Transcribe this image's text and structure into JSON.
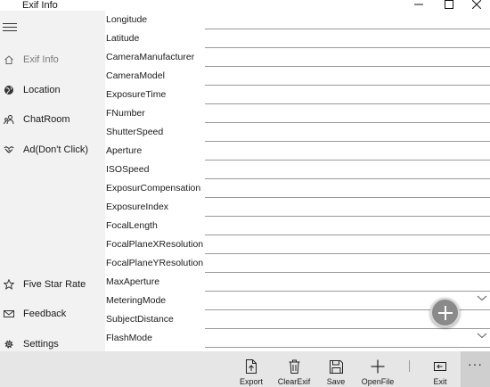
{
  "window": {
    "title": "Exif Info",
    "controls": [
      "minimize-icon",
      "maximize-icon",
      "close-icon"
    ]
  },
  "sidebar": {
    "menu_icon": "hamburger-icon",
    "top_items": [
      {
        "label": "Exif Info",
        "icon": "home-icon",
        "active": true
      },
      {
        "label": "Location",
        "icon": "globe-icon"
      },
      {
        "label": "ChatRoom",
        "icon": "people-icon"
      },
      {
        "label": "Ad(Don't Click)",
        "icon": "handshake-icon"
      }
    ],
    "bottom_items": [
      {
        "label": "Five Star Rate",
        "icon": "star-icon"
      },
      {
        "label": "Feedback",
        "icon": "mail-icon"
      },
      {
        "label": "Settings",
        "icon": "gear-icon"
      }
    ]
  },
  "fields": [
    {
      "label": "Longitude",
      "value": ""
    },
    {
      "label": "Latitude",
      "value": ""
    },
    {
      "label": "CameraManufacturer",
      "value": ""
    },
    {
      "label": "CameraModel",
      "value": ""
    },
    {
      "label": "ExposureTime",
      "value": ""
    },
    {
      "label": "FNumber",
      "value": ""
    },
    {
      "label": "ShutterSpeed",
      "value": ""
    },
    {
      "label": "Aperture",
      "value": ""
    },
    {
      "label": "ISOSpeed",
      "value": ""
    },
    {
      "label": "ExposurCompensation",
      "value": ""
    },
    {
      "label": "ExposureIndex",
      "value": ""
    },
    {
      "label": "FocalLength",
      "value": ""
    },
    {
      "label": "FocalPlaneXResolution",
      "value": ""
    },
    {
      "label": "FocalPlaneYResolution",
      "value": ""
    },
    {
      "label": "MaxAperture",
      "value": ""
    },
    {
      "label": "MeteringMode",
      "value": "",
      "dropdown": true
    },
    {
      "label": "SubjectDistance",
      "value": ""
    },
    {
      "label": "FlashMode",
      "value": "",
      "dropdown": true
    }
  ],
  "fab": {
    "icon": "plus-icon"
  },
  "commands": {
    "export": {
      "label": "Export",
      "icon": "export-file-icon"
    },
    "clear": {
      "label": "ClearExif",
      "icon": "trash-icon"
    },
    "save": {
      "label": "Save",
      "icon": "save-icon"
    },
    "open": {
      "label": "OpenFile",
      "icon": "plus-icon"
    },
    "exit": {
      "label": "Exit",
      "icon": "exit-icon"
    },
    "more": {
      "label": "···",
      "icon": "more-icon"
    }
  }
}
